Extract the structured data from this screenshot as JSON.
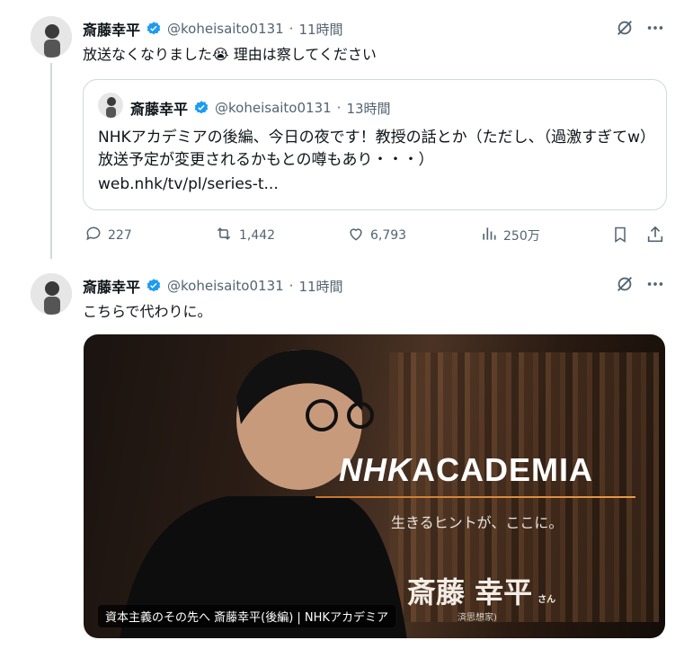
{
  "tweet1": {
    "author_name": "斎藤幸平",
    "handle": "@koheisaito0131",
    "separator": "·",
    "time": "11時間",
    "text": "放送なくなりました😭 理由は察してください",
    "quote": {
      "author_name": "斎藤幸平",
      "handle": "@koheisaito0131",
      "separator": "·",
      "time": "13時間",
      "text": "NHKアカデミアの後編、今日の夜です！教授の話とか（ただし、（過激すぎてw）放送予定が変更されるかもとの噂もあり・・・）",
      "link": "web.nhk/tv/pl/series-t..."
    },
    "stats": {
      "replies": "227",
      "reposts": "1,442",
      "likes": "6,793",
      "views": "250万"
    }
  },
  "tweet2": {
    "author_name": "斎藤幸平",
    "handle": "@koheisaito0131",
    "separator": "·",
    "time": "11時間",
    "text": "こちらで代わりに。",
    "media": {
      "logo_nhk": "NHK",
      "logo_academia": "ACADEMIA",
      "tagline": "生きるヒントが、ここに。",
      "speaker_name": "斎藤 幸平",
      "speaker_suffix": "さん",
      "speaker_role": "済思想家)",
      "caption": "資本主義のその先へ 斎藤幸平(後編) | NHKアカデミア"
    }
  },
  "colors": {
    "accent": "#1d9bf0",
    "muted": "#536471",
    "border": "#cfd9de"
  }
}
